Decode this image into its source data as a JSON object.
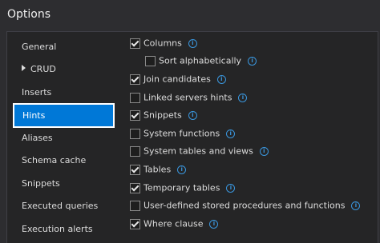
{
  "window": {
    "title": "Options"
  },
  "nav": {
    "items": [
      {
        "label": "General"
      },
      {
        "label": "CRUD"
      },
      {
        "label": "Inserts"
      },
      {
        "label": "Hints"
      },
      {
        "label": "Aliases"
      },
      {
        "label": "Schema cache"
      },
      {
        "label": "Snippets"
      },
      {
        "label": "Executed queries"
      },
      {
        "label": "Execution alerts"
      }
    ],
    "selected": "Hints"
  },
  "options": [
    {
      "label": "Columns",
      "checked": true,
      "info_icon": "info-icon"
    },
    {
      "label": "Sort alphabetically",
      "checked": false,
      "info_icon": "info-icon"
    },
    {
      "label": "Join candidates",
      "checked": true,
      "info_icon": "info-icon"
    },
    {
      "label": "Linked servers hints",
      "checked": false,
      "info_icon": "info-icon"
    },
    {
      "label": "Snippets",
      "checked": true,
      "info_icon": "info-icon"
    },
    {
      "label": "System functions",
      "checked": false,
      "info_icon": "info-icon"
    },
    {
      "label": "System tables and views",
      "checked": false,
      "info_icon": "info-icon"
    },
    {
      "label": "Tables",
      "checked": true,
      "info_icon": "info-icon"
    },
    {
      "label": "Temporary tables",
      "checked": true,
      "info_icon": "info-icon"
    },
    {
      "label": "User-defined stored procedures and functions",
      "checked": false,
      "info_icon": "info-icon"
    },
    {
      "label": "Where clause",
      "checked": true,
      "info_icon": "info-icon"
    }
  ],
  "colors": {
    "accent": "#0078d7",
    "info": "#3a96dd",
    "background": "#2d2d30"
  }
}
